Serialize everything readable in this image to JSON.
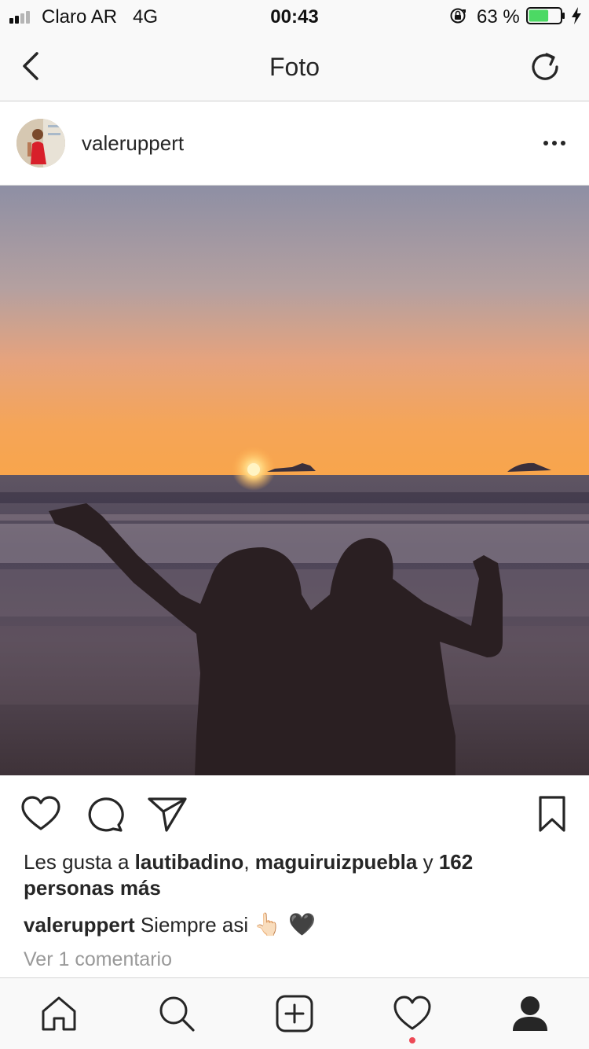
{
  "status_bar": {
    "carrier": "Claro AR",
    "network": "4G",
    "time": "00:43",
    "battery_percent_text": "63 %",
    "battery_level": 0.63,
    "signal_bars": 2,
    "battery_color": "#4cd964"
  },
  "header": {
    "title": "Foto",
    "back_icon": "chevron-left-icon",
    "refresh_icon": "refresh-icon"
  },
  "post": {
    "username": "valeruppert",
    "more_icon": "more-horizontal-icon",
    "likes": {
      "prefix": "Les gusta a ",
      "user1": "lautibadino",
      "separator": ", ",
      "user2": "maguiruizpuebla",
      "connector": " y ",
      "others": "162 personas más"
    },
    "caption": {
      "username": "valeruppert",
      "text": "Siempre asi",
      "emoji": "👆🏻 🖤"
    },
    "comments_link": "Ver 1 comentario"
  },
  "tabbar": {
    "items": [
      "home-icon",
      "search-icon",
      "new-post-icon",
      "activity-icon",
      "profile-icon"
    ],
    "notification_color": "#ed4956"
  }
}
